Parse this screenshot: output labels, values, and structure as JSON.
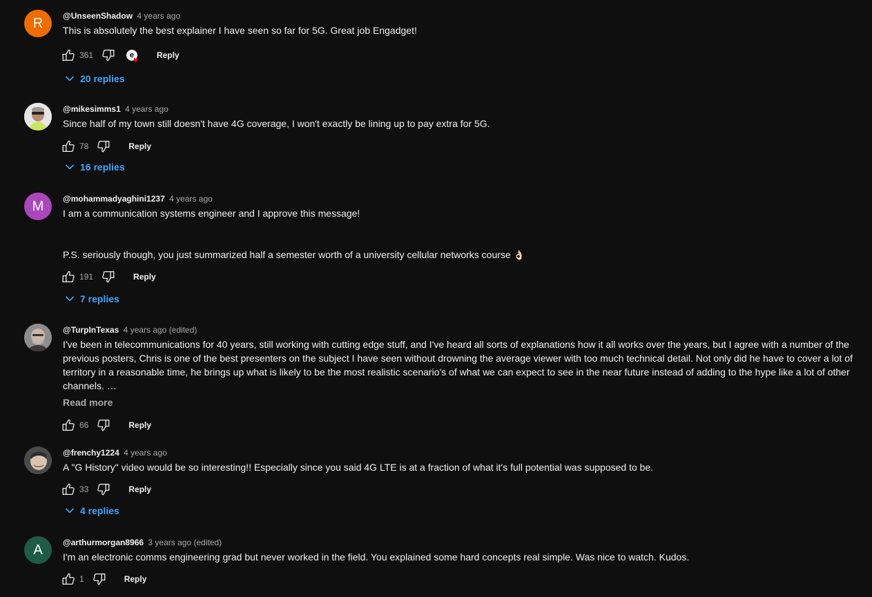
{
  "comments": [
    {
      "author": "@UnseenShadow",
      "time": "4 years ago",
      "edited": "",
      "avatar_letter": "R",
      "avatar_color": "#ef6c00",
      "lines": [
        "This is absolutely the best explainer I have seen so far for 5G. Great job Engadget!"
      ],
      "likes": "361",
      "creator_heart_letter": "e",
      "reply_label": "Reply",
      "replies_label": "20 replies"
    },
    {
      "author": "@mikesimms1",
      "time": "4 years ago",
      "edited": "",
      "avatar_letter": "",
      "avatar_color": "#e8e8e8",
      "lines": [
        "Since half of my town still doesn't have 4G coverage, I won't exactly be lining up to pay extra for 5G."
      ],
      "likes": "78",
      "reply_label": "Reply",
      "replies_label": "16 replies"
    },
    {
      "author": "@mohammadyaghini1237",
      "time": "4 years ago",
      "edited": "",
      "avatar_letter": "M",
      "avatar_color": "#ab47bc",
      "lines": [
        "I am a communication systems engineer and I approve this message!",
        "",
        "",
        "P.S. seriously though, you just summarized half a semester worth of a university cellular networks course"
      ],
      "emoji": "👌🏻",
      "likes": "191",
      "reply_label": "Reply",
      "replies_label": "7 replies"
    },
    {
      "author": "@TurpInTexas",
      "time": "4 years ago",
      "edited": "(edited)",
      "avatar_letter": "",
      "avatar_color": "#9e9e9e",
      "lines": [
        "I've been in telecommunications for 40 years, still working with cutting edge stuff, and I've heard all sorts of explanations how it all works over the years, but I agree with a number of the previous posters, Chris is one of the best presenters on the subject I have seen without drowning the average viewer with too much technical detail.  Not only did he have to cover a lot of territory in a reasonable time, he brings up what is likely to be the most realistic scenario's of what we can expect to see in the near future instead of adding to the hype like a lot of other channels.   …"
      ],
      "read_more": "Read more",
      "likes": "66",
      "reply_label": "Reply"
    },
    {
      "author": "@frenchy1224",
      "time": "4 years ago",
      "edited": "",
      "avatar_letter": "",
      "avatar_color": "#5d5d5d",
      "lines": [
        "A \"G History\" video would be so interesting!! Especially since you said 4G LTE is at a fraction of what it's full potential was supposed to be."
      ],
      "likes": "33",
      "reply_label": "Reply",
      "replies_label": "4 replies"
    },
    {
      "author": "@arthurmorgan8966",
      "time": "3 years ago",
      "edited": "(edited)",
      "avatar_letter": "A",
      "avatar_color": "#1e5b47",
      "lines": [
        "I'm an electronic comms engineering grad but never worked in the field. You explained some hard concepts real simple. Was nice to watch. Kudos."
      ],
      "likes": "1",
      "reply_label": "Reply"
    }
  ],
  "icons": {
    "like": "thumb-up-outline-icon",
    "dislike": "thumb-down-outline-icon",
    "chevron": "chevron-down-icon",
    "heart": "heart-icon"
  }
}
